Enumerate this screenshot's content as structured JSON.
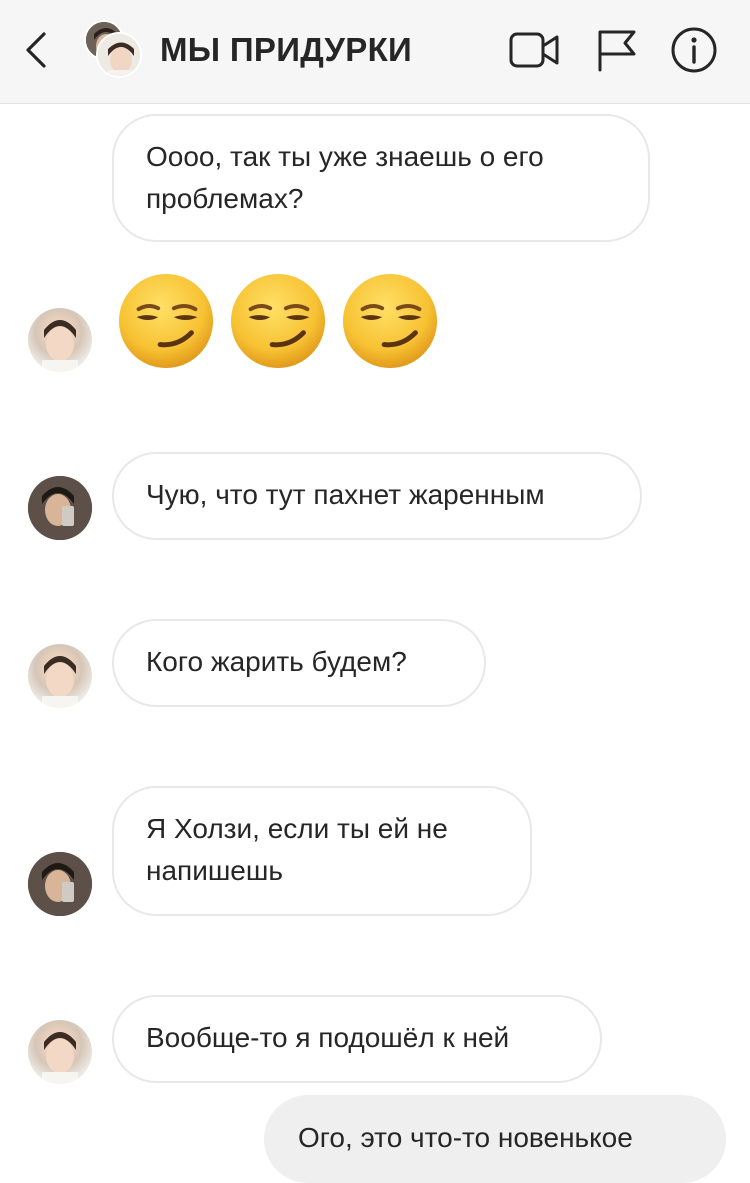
{
  "header": {
    "title": "МЫ ПРИДУРКИ",
    "icons": [
      "back-icon",
      "video-camera-icon",
      "flag-icon",
      "info-icon"
    ]
  },
  "messages": [
    {
      "id": "m1",
      "text": "Оооо, так ты уже знаешь о его проблемах?",
      "line1": "Оооо, так ты уже знаешь о его",
      "line2": "проблемах?",
      "sender": "other"
    },
    {
      "id": "m2",
      "emoji": [
        "smirk",
        "smirk",
        "smirk"
      ],
      "sender": "other",
      "avatar": "light"
    },
    {
      "id": "m3",
      "text": "Чую, что тут пахнет жаренным",
      "sender": "other",
      "avatar": "dark"
    },
    {
      "id": "m4",
      "text": "Кого жарить будем?",
      "sender": "other",
      "avatar": "light"
    },
    {
      "id": "m5",
      "line1": "Я Холзи, если ты ей не",
      "line2": "напишешь",
      "sender": "other",
      "avatar": "dark"
    },
    {
      "id": "m6",
      "text": "Вообще-то я подошёл к ней",
      "sender": "other",
      "avatar": "light"
    },
    {
      "id": "m7",
      "text": "Ого, это что-то новенькое",
      "sender": "me"
    }
  ],
  "colors": {
    "header_bg": "#f7f6f7",
    "text": "#262626",
    "bubble_border": "#e8e8e8",
    "my_bubble": "#efefef",
    "emoji_yellow": "#f7c233"
  }
}
